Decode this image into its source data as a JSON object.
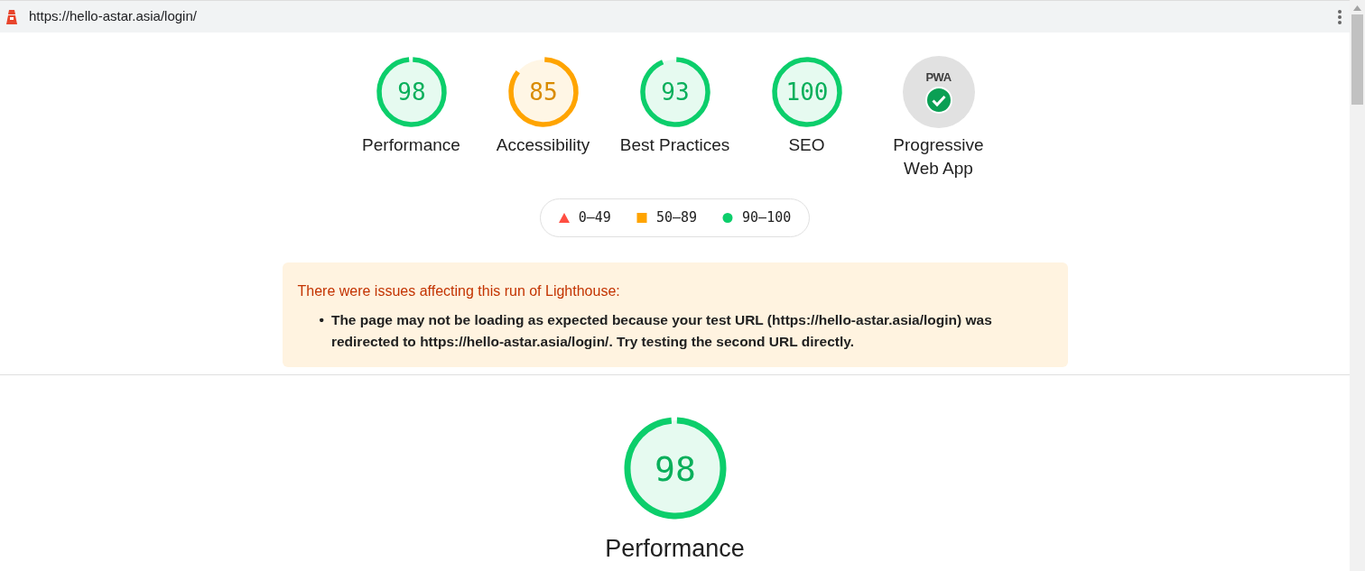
{
  "address_bar": {
    "url": "https://hello-astar.asia/login/"
  },
  "categories": [
    {
      "kind": "gauge",
      "score": "98",
      "level": 0.98,
      "color": "#0cce6b",
      "label": "Performance"
    },
    {
      "kind": "gauge",
      "score": "85",
      "level": 0.85,
      "color": "#ffa400",
      "label": "Accessibility"
    },
    {
      "kind": "gauge",
      "score": "93",
      "level": 0.93,
      "color": "#0cce6b",
      "label": "Best Practices"
    },
    {
      "kind": "gauge",
      "score": "100",
      "level": 1,
      "color": "#0cce6b",
      "label": "SEO"
    },
    {
      "kind": "pwa",
      "logo": "PWA",
      "label": "Progressive Web App"
    }
  ],
  "legend": [
    {
      "kind": "fail",
      "range": "0–49"
    },
    {
      "kind": "average",
      "range": "50–89"
    },
    {
      "kind": "pass",
      "range": "90–100"
    }
  ],
  "warning": {
    "title": "There were issues affecting this run of Lighthouse:",
    "bullet": "•",
    "items": [
      "The page may not be loading as expected because your test URL (https://hello-astar.asia/login) was redirected to https://hello-astar.asia/login/. Try testing the second URL directly."
    ]
  },
  "main_gauge": {
    "score": "98",
    "level": 0.98,
    "color": "#0cce6b",
    "label": "Performance"
  }
}
